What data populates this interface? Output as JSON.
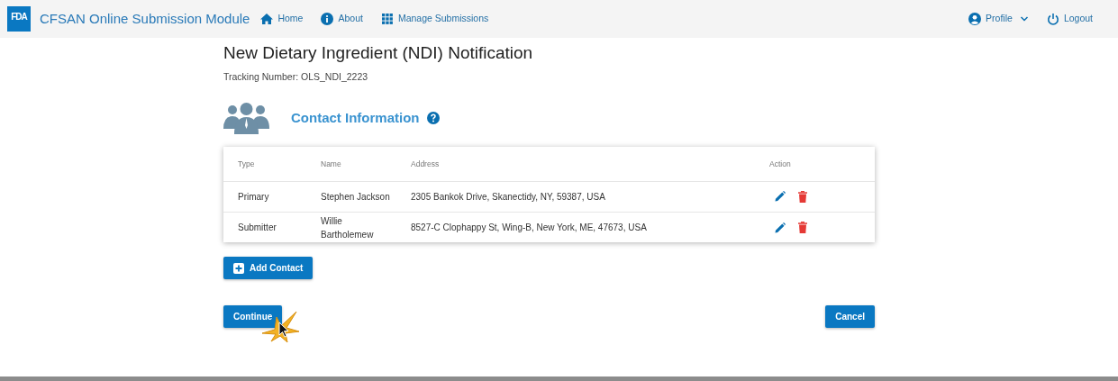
{
  "navbar": {
    "logo": "FDA",
    "title": "CFSAN Online Submission Module",
    "links": [
      {
        "kind": "home",
        "label": "Home"
      },
      {
        "kind": "about",
        "label": "About"
      },
      {
        "kind": "grid",
        "label": "Manage Submissions"
      }
    ],
    "right": [
      {
        "kind": "profile",
        "label": "Profile"
      },
      {
        "kind": "logout",
        "label": "Logout"
      }
    ]
  },
  "page": {
    "title": "New Dietary Ingredient (NDI) Notification",
    "tracking": "Tracking Number: OLS_NDI_2223"
  },
  "section": {
    "title": "Contact Information"
  },
  "table": {
    "columns": [
      "Type",
      "Name",
      "Address",
      "Action"
    ],
    "rows": [
      {
        "type": "Primary",
        "name": "Stephen Jackson",
        "address": "2305 Bankok Drive, Skanectidy, NY, 59387, USA"
      },
      {
        "type": "Submitter",
        "name": "Willie Bartholemew",
        "address": "8527-C Clophappy St, Wing-B, New York, ME, 47673, USA"
      }
    ]
  },
  "buttons": {
    "add": "Add Contact",
    "continue": "Continue",
    "cancel": "Cancel"
  }
}
